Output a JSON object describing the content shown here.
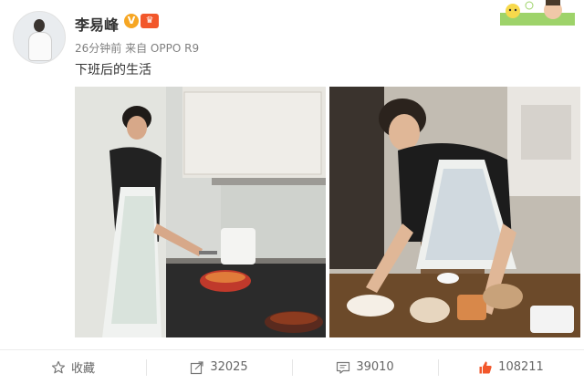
{
  "post": {
    "author": "李易峰",
    "verified_badge": "V",
    "member_badge": "♛",
    "time": "26分钟前",
    "source": "来自 OPPO R9",
    "text": "下班后的生活"
  },
  "actions": {
    "favorite": "收藏",
    "repost_count": "32025",
    "comment_count": "39010",
    "like_count": "108211"
  },
  "colors": {
    "like_accent": "#f2572b",
    "verified": "#f6a623"
  },
  "icons": {
    "favorite": "star-icon",
    "repost": "share-icon",
    "comment": "comment-icon",
    "like": "thumbs-up-icon"
  }
}
